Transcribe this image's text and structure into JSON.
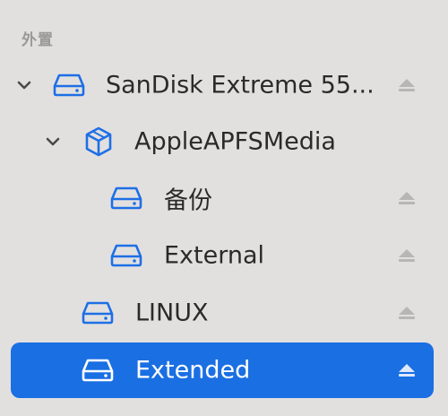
{
  "section": {
    "title": "外置"
  },
  "items": [
    {
      "label": "SanDisk Extreme 55...",
      "icon": "external-drive-icon",
      "chevron": "chevron-down-icon",
      "ejectable": true
    },
    {
      "label": "AppleAPFSMedia",
      "icon": "container-cube-icon",
      "chevron": "chevron-down-icon",
      "ejectable": false
    },
    {
      "label": "备份",
      "icon": "volume-drive-icon",
      "ejectable": true
    },
    {
      "label": "External",
      "icon": "volume-drive-icon",
      "ejectable": true
    },
    {
      "label": "LINUX",
      "icon": "volume-drive-icon",
      "ejectable": true
    },
    {
      "label": "Extended",
      "icon": "volume-drive-icon",
      "ejectable": true,
      "selected": true
    }
  ],
  "colors": {
    "background": "#e2e0df",
    "accent": "#1a6fe3",
    "icon_blue": "#1e6fe6",
    "text": "#2a2a2a",
    "muted": "#9b9998"
  }
}
